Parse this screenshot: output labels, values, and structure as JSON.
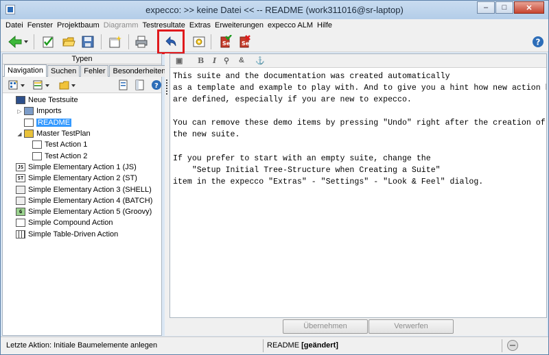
{
  "window": {
    "title": "expecco: >> keine Datei << -- README (work311016@sr-laptop)",
    "controls": {
      "minimize": "–",
      "maximize": "□",
      "close": "✕"
    }
  },
  "menubar": [
    {
      "label": "Datei",
      "enabled": true
    },
    {
      "label": "Fenster",
      "enabled": true
    },
    {
      "label": "Projektbaum",
      "enabled": true
    },
    {
      "label": "Diagramm",
      "enabled": false
    },
    {
      "label": "Testresultate",
      "enabled": true
    },
    {
      "label": "Extras",
      "enabled": true
    },
    {
      "label": "Erweiterungen",
      "enabled": true
    },
    {
      "label": "expecco ALM",
      "enabled": true
    },
    {
      "label": "Hilfe",
      "enabled": true
    }
  ],
  "toolbar": {
    "icons": [
      "back-arrow-icon",
      "checklist-icon",
      "open-folder-icon",
      "save-icon",
      "new-window-icon",
      "print-icon",
      "undo-icon",
      "settings-icon",
      "run-test-icon",
      "stop-test-icon",
      "help-icon"
    ],
    "highlighted": "undo-icon",
    "highlight_color": "#e0191c"
  },
  "left_panel": {
    "types_header": "Typen",
    "tabs": [
      {
        "label": "Navigation",
        "active": true
      },
      {
        "label": "Suchen",
        "active": false
      },
      {
        "label": "Fehler",
        "active": false
      },
      {
        "label": "Besonderheiten",
        "active": false
      }
    ],
    "tree": [
      {
        "label": "Neue Testsuite",
        "icon": "suite-icon",
        "glyph": "",
        "level": 0,
        "expander": "",
        "selected": false
      },
      {
        "label": "Imports",
        "icon": "imports-icon",
        "glyph": "",
        "level": 1,
        "expander": "▷",
        "selected": false
      },
      {
        "label": "README",
        "icon": "document-icon",
        "glyph": "",
        "level": 1,
        "expander": "",
        "selected": true
      },
      {
        "label": "Master TestPlan",
        "icon": "testplan-icon",
        "glyph": "",
        "level": 1,
        "expander": "◢",
        "selected": false
      },
      {
        "label": "Test Action 1",
        "icon": "test-action-icon",
        "glyph": "",
        "level": 2,
        "expander": "",
        "selected": false
      },
      {
        "label": "Test Action 2",
        "icon": "test-action-icon",
        "glyph": "",
        "level": 2,
        "expander": "",
        "selected": false
      },
      {
        "label": "Simple Elementary Action 1 (JS)",
        "icon": "js-action-icon",
        "glyph": "JS",
        "level": 0,
        "expander": "",
        "selected": false
      },
      {
        "label": "Simple Elementary Action 2 (ST)",
        "icon": "st-action-icon",
        "glyph": "ST",
        "level": 0,
        "expander": "",
        "selected": false
      },
      {
        "label": "Simple Elementary Action 3 (SHELL)",
        "icon": "shell-action-icon",
        "glyph": "",
        "level": 0,
        "expander": "",
        "selected": false
      },
      {
        "label": "Simple Elementary Action 4 (BATCH)",
        "icon": "batch-action-icon",
        "glyph": "",
        "level": 0,
        "expander": "",
        "selected": false
      },
      {
        "label": "Simple Elementary Action 5 (Groovy)",
        "icon": "groovy-action-icon",
        "glyph": "G",
        "level": 0,
        "expander": "",
        "selected": false
      },
      {
        "label": "Simple Compound Action",
        "icon": "compound-action-icon",
        "glyph": "",
        "level": 0,
        "expander": "",
        "selected": false
      },
      {
        "label": "Simple Table-Driven Action",
        "icon": "table-action-icon",
        "glyph": "",
        "level": 0,
        "expander": "",
        "selected": false
      }
    ]
  },
  "editor": {
    "text": "This suite and the documentation was created automatically\nas a template and example to play with. And to give you a hint how new action b\nare defined, especially if you are new to expecco.\n\nYou can remove these demo items by pressing \"Undo\" right after the creation of\nthe new suite.\n\nIf you prefer to start with an empty suite, change the\n    \"Setup Initial Tree-Structure when Creating a Suite\"\nitem in the expecco \"Extras\" - \"Settings\" - \"Look & Feel\" dialog."
  },
  "buttons": {
    "apply": "Übernehmen",
    "discard": "Verwerfen"
  },
  "status": {
    "last_action": "Letzte Aktion: Initiale Baumelemente anlegen",
    "document": "README",
    "changed": "[geändert]"
  }
}
